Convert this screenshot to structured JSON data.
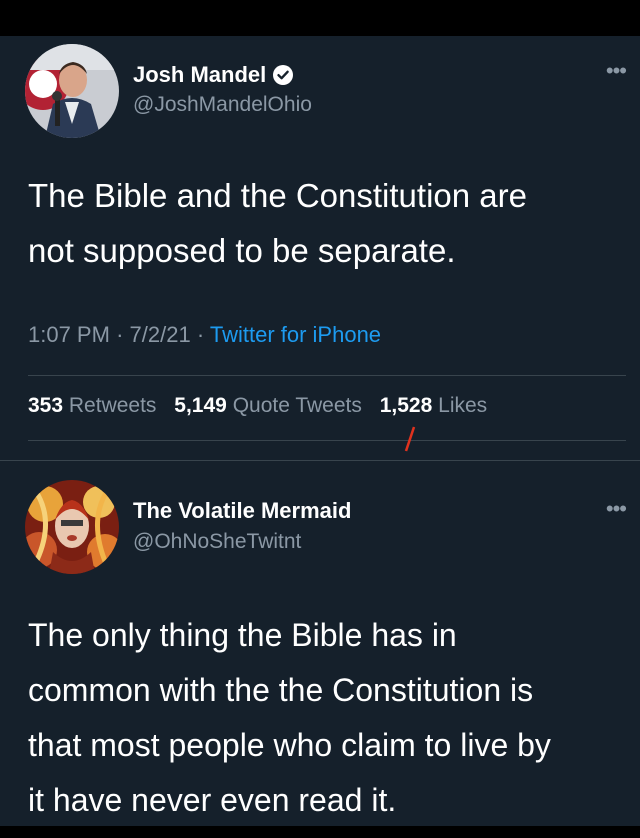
{
  "tweet1": {
    "display_name": "Josh Mandel",
    "handle": "@JoshMandelOhio",
    "text_line1": "The Bible and the Constitution are",
    "text_line2": "not supposed to be separate.",
    "time": "1:07 PM",
    "date": "7/2/21",
    "source": "Twitter for iPhone",
    "stats": [
      {
        "count": "353",
        "label": "Retweets"
      },
      {
        "count": "5,149",
        "label": "Quote Tweets"
      },
      {
        "count": "1,528",
        "label": "Likes"
      }
    ]
  },
  "tweet2": {
    "display_name": "The Volatile Mermaid",
    "handle": "@OhNoSheTwitnt",
    "text_line1": "The only thing the Bible has in",
    "text_line2": "common with the the Constitution is",
    "text_line3": "that most people who claim to live by",
    "text_line4": "it have never even read it."
  },
  "more_icon": "more-horizontal-icon",
  "colors": {
    "background": "#15202b",
    "secondary_text": "#8b98a5",
    "link": "#1d9bf0",
    "verified": "#ffffff",
    "annotation_mark": "#e0321e"
  }
}
